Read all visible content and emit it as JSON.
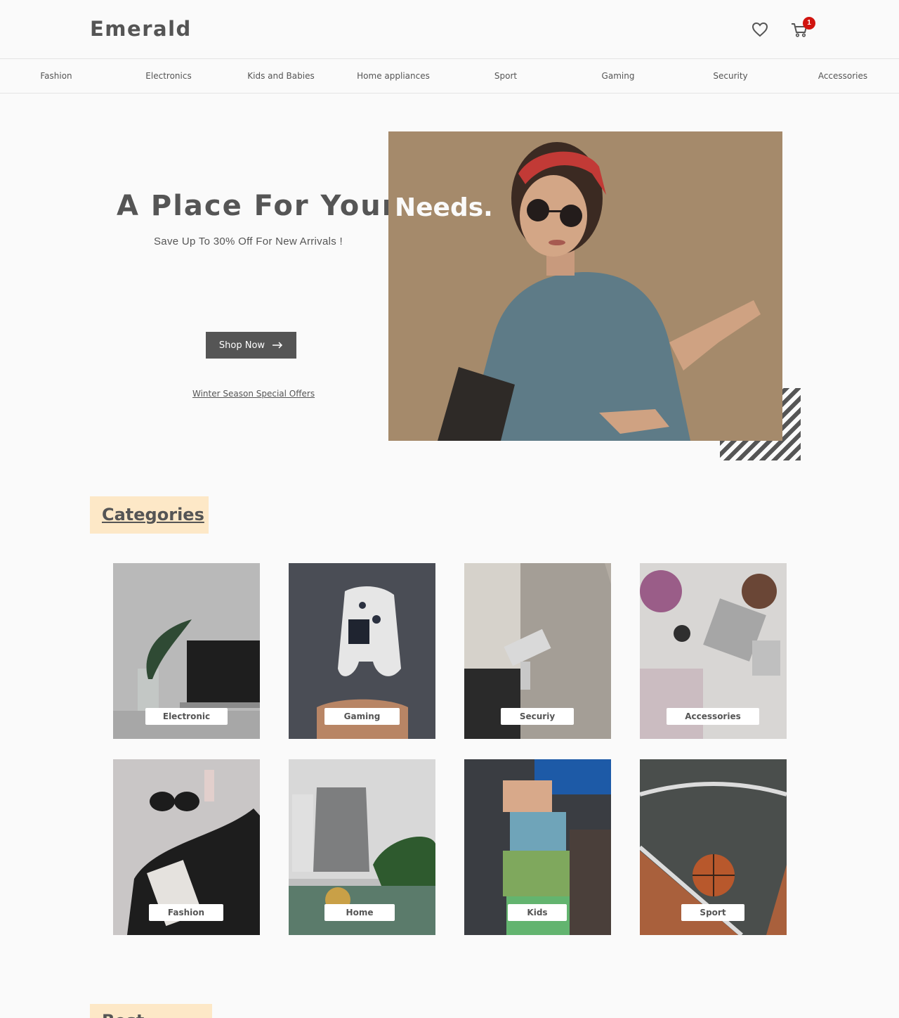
{
  "header": {
    "logo": "Emerald",
    "cart_count": "1",
    "icons": [
      "heart-icon",
      "cart-icon"
    ]
  },
  "nav": {
    "items": [
      "Fashion",
      "Electronics",
      "Kids and Babies",
      "Home appliances",
      "Sport",
      "Gaming",
      "Security",
      "Accessories"
    ]
  },
  "hero": {
    "title_left": "A Place For Your",
    "title_right": "Needs.",
    "subtitle": "Save Up To 30% Off For New Arrivals !",
    "button_label": "Shop Now",
    "link_text": "Winter Season Special Offers"
  },
  "categories": {
    "title": "Categories",
    "items": [
      {
        "label": "Electronic"
      },
      {
        "label": "Gaming"
      },
      {
        "label": "Securiy"
      },
      {
        "label": "Accessories"
      },
      {
        "label": "Fashion"
      },
      {
        "label": "Home"
      },
      {
        "label": "Kids"
      },
      {
        "label": "Sport"
      }
    ]
  },
  "best_sellers": {
    "title": "Best Sellers"
  },
  "colors": {
    "text": "#555555",
    "accent_tag": "#fde8c7",
    "badge": "#d1140f",
    "background": "#fafafa"
  }
}
